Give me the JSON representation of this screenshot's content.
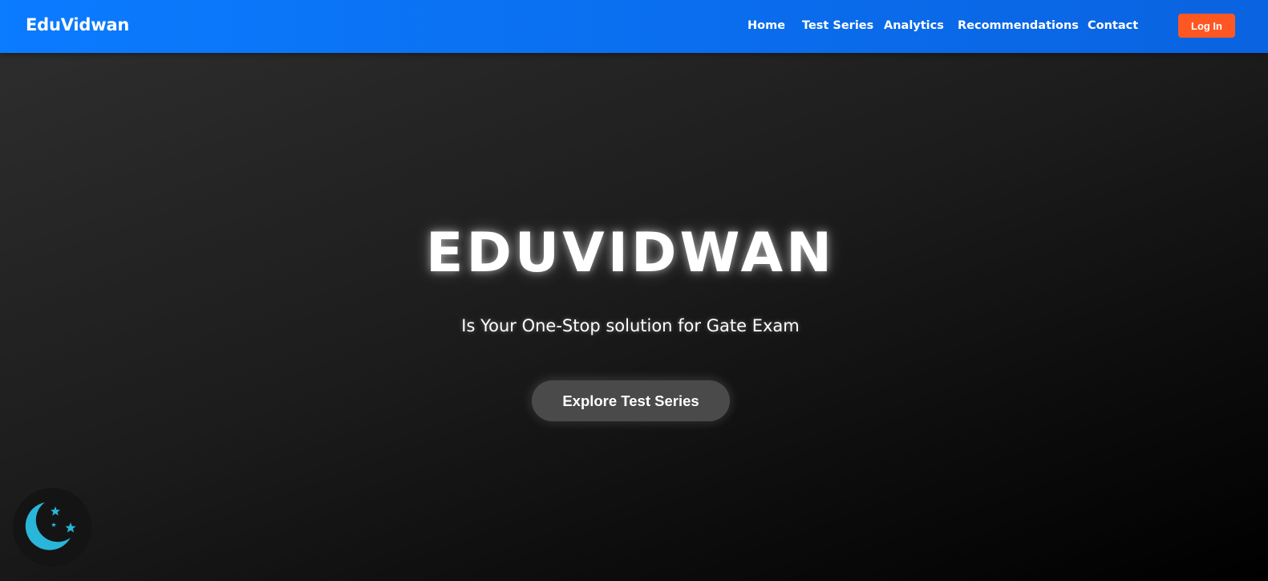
{
  "navbar": {
    "brand": "EduVidwan",
    "links": [
      "Home",
      "Test Series",
      "Analytics",
      "Recommendations",
      "Contact"
    ],
    "login_label": "Log In"
  },
  "hero": {
    "title": "EDUVIDWAN",
    "subtitle": "Is Your One-Stop solution for Gate Exam",
    "cta_label": "Explore Test Series"
  },
  "theme_toggle": {
    "icon": "moon-stars-icon",
    "accent_color": "#29b6d8"
  },
  "colors": {
    "navbar": "#0b7bff",
    "login_button": "#ff5722",
    "cta_button": "#4a4a4a"
  }
}
